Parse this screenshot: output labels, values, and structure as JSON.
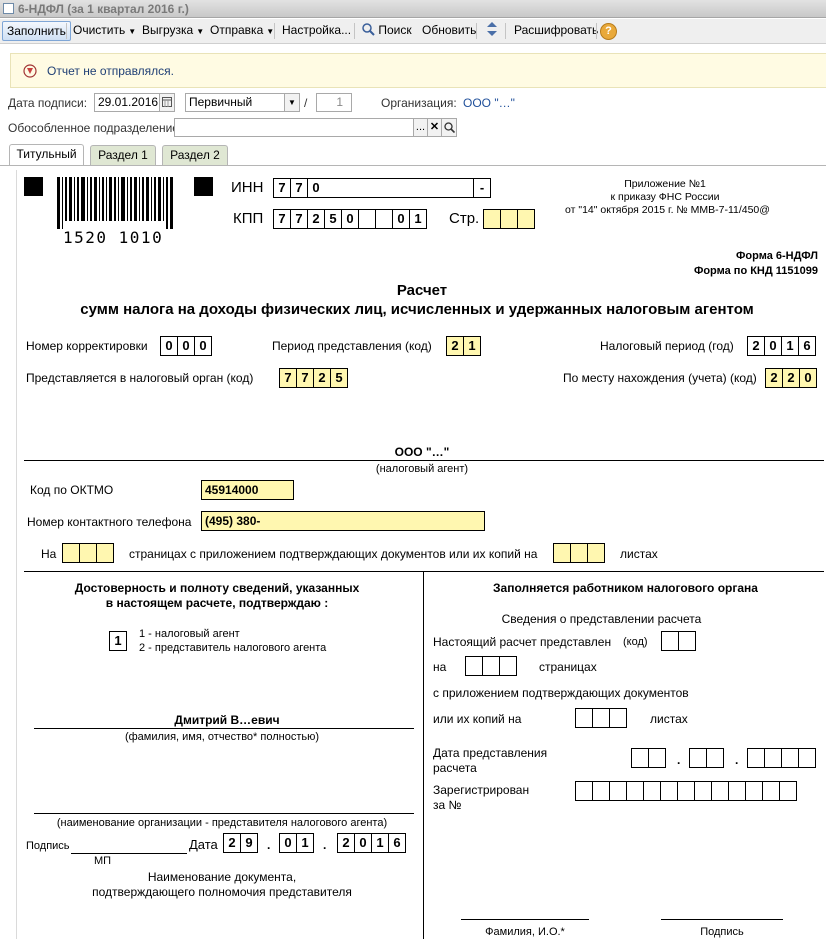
{
  "window": {
    "title": "6-НДФЛ (за 1 квартал 2016 г.)"
  },
  "toolbar": {
    "fill": "Заполнить",
    "clear": "Очистить",
    "export": "Выгрузка",
    "send": "Отправка",
    "settings": "Настройка...",
    "search": "Поиск",
    "refresh": "Обновить",
    "decode": "Расшифровать",
    "help": "?"
  },
  "notice": {
    "text": "Отчет не отправлялся."
  },
  "header": {
    "sign_date_label": "Дата подписи:",
    "sign_date": "29.01.2016",
    "kind": "Первичный",
    "slash": "/",
    "corr_num": "1",
    "org_label": "Организация:",
    "org_value": "ООО \"…\"",
    "division_label": "Обособленное подразделение:",
    "division_value": "",
    "dots": "..."
  },
  "tabs": [
    "Титульный",
    "Раздел 1",
    "Раздел 2"
  ],
  "form": {
    "barcode_number": "1520 1010",
    "inn_label": "ИНН",
    "inn": [
      "7",
      "7",
      "0"
    ],
    "inn_tail": "-",
    "kpp_label": "КПП",
    "kpp": [
      "7",
      "7",
      "2",
      "5",
      "0",
      "",
      "",
      "0",
      "1"
    ],
    "page_label": "Стр.",
    "appendix": [
      "Приложение №1",
      "к приказу ФНС России",
      "от \"14\" октября 2015 г. № ММВ-7-11/450@"
    ],
    "form_name": "Форма 6-НДФЛ",
    "form_knd": "Форма по КНД 1151099",
    "title1": "Расчет",
    "title2": "сумм налога на доходы физических лиц, исчисленных и удержанных налоговым агентом",
    "corr_label": "Номер корректировки",
    "corr": [
      "0",
      "0",
      "0"
    ],
    "period_label": "Период представления  (код)",
    "period": [
      "2",
      "1"
    ],
    "tax_period_label": "Налоговый период (год)",
    "tax_period": [
      "2",
      "0",
      "1",
      "6"
    ],
    "authority_label": "Представляется в налоговый орган   (код)",
    "authority": [
      "7",
      "7",
      "2",
      "5"
    ],
    "location_label": "По месту нахождения (учета)  (код)",
    "location": [
      "2",
      "2",
      "0"
    ],
    "agent_name": "ООО  \"…\"",
    "agent_caption": "(налоговый агент)",
    "oktmo_label": "Код по ОКТМО",
    "oktmo": "45914000",
    "phone_label": "Номер контактного телефона",
    "phone": "(495) 380-",
    "pages_on": "На",
    "pages_mid": "страницах с приложением подтверждающих документов или их копий на",
    "pages_sheets": "листах",
    "left_head1": "Достоверность и полноту сведений, указанных",
    "left_head2": "в настоящем расчете, подтверждаю :",
    "signer_code": "1",
    "signer_opt1": "1 - налоговый агент",
    "signer_opt2": "2 - представитель налогового агента",
    "signer_name": "Дмитрий В…евич",
    "signer_caption": "(фамилия, имя, отчество* полностью)",
    "org_rep_caption": "(наименование организации - представителя налогового агента)",
    "sign_label": "Подпись",
    "date_label": "Дата",
    "mp": "МП",
    "date_digits": [
      "2",
      "9",
      "0",
      "1",
      "2",
      "0",
      "1",
      "6"
    ],
    "doc_name1": "Наименование документа,",
    "doc_name2": "подтверждающего полномочия представителя",
    "right_head": "Заполняется работником налогового органа",
    "right_sub": "Сведения о представлении расчета",
    "presented_label": "Настоящий расчет представлен",
    "code_label": "(код)",
    "on_label": "на",
    "pages_label": "страницах",
    "with_docs": "с приложением подтверждающих документов",
    "or_copies": "или их копий на",
    "sheets_label": "листах",
    "date_presented1": "Дата представления",
    "date_presented2": "расчета",
    "registered1": "Зарегистрирован",
    "registered2": "за №",
    "fio_caption": "Фамилия, И.О.*",
    "sign_caption": "Подпись"
  }
}
